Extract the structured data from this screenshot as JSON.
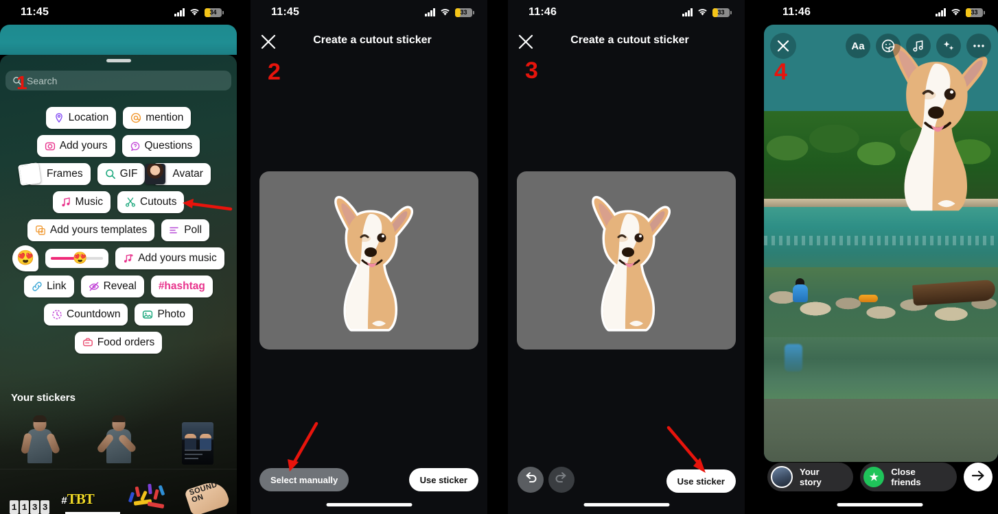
{
  "panels": [
    {
      "id": "sticker-tray",
      "status": {
        "time": "11:45",
        "battery": "34"
      },
      "annotation": "1",
      "search": {
        "placeholder": "Search",
        "icon": "search-icon"
      },
      "chip_rows": [
        [
          {
            "label": "Location",
            "icon": "location-pin-icon",
            "color": "#7b3ff2"
          },
          {
            "label": "mention",
            "icon": "at-mention-icon",
            "color": "#f0962c"
          }
        ],
        [
          {
            "label": "Add yours",
            "icon": "camera-icon",
            "color": "#e8338c"
          },
          {
            "label": "Questions",
            "icon": "question-bubble-icon",
            "color": "#c040d6"
          }
        ],
        [
          {
            "label": "Frames",
            "icon": "polaroid-frames-icon",
            "color": "#ffffff"
          },
          {
            "label": "GIF",
            "icon": "gif-search-icon",
            "color": "#17a67a"
          },
          {
            "label": "Avatar",
            "icon": "avatar-face-icon",
            "color": "#2a2a2a"
          }
        ],
        [
          {
            "label": "Music",
            "icon": "music-note-icon",
            "color": "#e8338c"
          },
          {
            "label": "Cutouts",
            "icon": "scissors-icon",
            "color": "#17a67a"
          }
        ],
        [
          {
            "label": "Add yours templates",
            "icon": "template-plus-icon",
            "color": "#f0962c"
          },
          {
            "label": "Poll",
            "icon": "poll-bars-icon",
            "color": "#b84fd6"
          }
        ],
        [
          {
            "label": "",
            "icon": "emoji-heart-eyes-icon",
            "color": "#f5b83d"
          },
          {
            "label": "",
            "icon": "emoji-slider-icon",
            "color": "#ef2a78"
          },
          {
            "label": "Add yours music",
            "icon": "music-plus-icon",
            "color": "#e8338c"
          }
        ],
        [
          {
            "label": "Link",
            "icon": "link-chain-icon",
            "color": "#38a6d6"
          },
          {
            "label": "Reveal",
            "icon": "reveal-eye-slash-icon",
            "color": "#c040d6"
          },
          {
            "label": "#hashtag",
            "icon": "hashtag-icon",
            "color": "#e8338c"
          }
        ],
        [
          {
            "label": "Countdown",
            "icon": "countdown-clock-icon",
            "color": "#c040d6"
          },
          {
            "label": "Photo",
            "icon": "photo-image-icon",
            "color": "#17a67a"
          }
        ],
        [
          {
            "label": "Food orders",
            "icon": "food-order-icon",
            "color": "#e8456a"
          }
        ]
      ],
      "your_stickers_label": "Your stickers",
      "sticker_items_row1": [
        "person-pointing-sticker",
        "person-thinking-sticker",
        "group-photo-sticker"
      ],
      "sticker_items_row2": [
        "counter-1133-sticker",
        "tbt-sticker",
        "confetti-sticker",
        "sound-on-sticker"
      ],
      "counter_digits": [
        "1",
        "1",
        "3",
        "3"
      ],
      "tbt_hash": "#",
      "tbt_text": "TBT",
      "sound_on_line1": "SOUND",
      "sound_on_line2": "ON"
    },
    {
      "id": "cutout-create-auto",
      "status": {
        "time": "11:45",
        "battery": "33"
      },
      "annotation": "2",
      "title": "Create a cutout sticker",
      "close_icon": "close-x-icon",
      "sticker_subject": "corgi-puppy-cutout",
      "buttons": {
        "secondary": "Select manually",
        "primary": "Use sticker"
      }
    },
    {
      "id": "cutout-create-manual",
      "status": {
        "time": "11:46",
        "battery": "33"
      },
      "annotation": "3",
      "title": "Create a cutout sticker",
      "close_icon": "close-x-icon",
      "sticker_subject": "corgi-puppy-cutout",
      "buttons": {
        "undo": "undo-arrow-icon",
        "redo": "redo-arrow-icon",
        "primary": "Use sticker"
      }
    },
    {
      "id": "story-composer",
      "status": {
        "time": "11:46",
        "battery": "33"
      },
      "annotation": "4",
      "close_icon": "close-x-icon",
      "tools": [
        {
          "name": "text-tool",
          "icon": "text-aa-icon",
          "label": "Aa"
        },
        {
          "name": "sticker-tool",
          "icon": "sticker-smiley-icon",
          "label": ""
        },
        {
          "name": "music-tool",
          "icon": "music-note-icon",
          "label": ""
        },
        {
          "name": "effects-tool",
          "icon": "sparkles-icon",
          "label": ""
        },
        {
          "name": "more-tool",
          "icon": "more-dots-icon",
          "label": ""
        }
      ],
      "audience": [
        {
          "label": "Your story",
          "icon": "user-avatar-icon"
        },
        {
          "label": "Close friends",
          "icon": "close-friends-star-icon"
        }
      ],
      "send": {
        "icon": "arrow-right-icon"
      },
      "background_scene": "river-forest-boat-photo",
      "placed_sticker": "corgi-puppy-cutout"
    }
  ],
  "colors": {
    "accent_red": "#e8140c",
    "teal_story": "#2a7d80",
    "tray_dark": "#123631",
    "editor_bg": "#0c0d10",
    "card_grey": "#6b6b6b",
    "close_friends_green": "#1fc45a",
    "battery_yellow": "#f5c518"
  }
}
